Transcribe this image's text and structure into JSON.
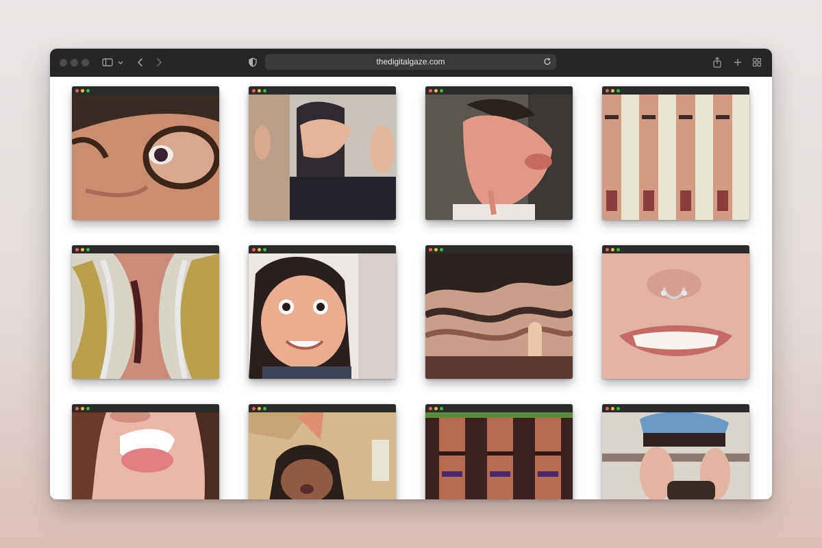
{
  "browser": {
    "url": "thedigitalgaze.com",
    "toolbar_icons": [
      "sidebar-icon",
      "chevron-down-icon",
      "back-icon",
      "forward-icon",
      "shield-icon",
      "reload-icon",
      "share-icon",
      "new-tab-icon",
      "tab-overview-icon"
    ]
  },
  "gallery": {
    "tiles": [
      {
        "name": "tile-1",
        "content": "close-up face with glasses"
      },
      {
        "name": "tile-2",
        "content": "warped group selfie"
      },
      {
        "name": "tile-3",
        "content": "distorted face profile"
      },
      {
        "name": "tile-4",
        "content": "repeated stretched face"
      },
      {
        "name": "tile-5",
        "content": "swirled mirrored face"
      },
      {
        "name": "tile-6",
        "content": "bulging face selfie"
      },
      {
        "name": "tile-7",
        "content": "wavy distorted face"
      },
      {
        "name": "tile-8",
        "content": "close-up mouth with nose ring"
      },
      {
        "name": "tile-9",
        "content": "open mouth tongue out"
      },
      {
        "name": "tile-10",
        "content": "party hat selfie"
      },
      {
        "name": "tile-11",
        "content": "repeated wavy faces"
      },
      {
        "name": "tile-12",
        "content": "stretched face with cap"
      }
    ]
  },
  "colors": {
    "toolbar": "#262626",
    "address_bar": "#3a3a3a",
    "traffic_red": "#ff5f57",
    "traffic_yellow": "#febc2e",
    "traffic_green": "#28c840"
  }
}
